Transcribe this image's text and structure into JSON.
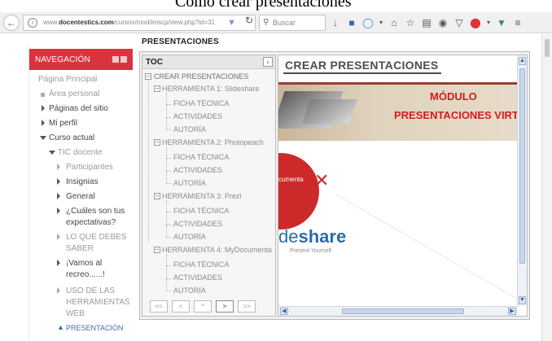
{
  "caption": "Cómo crear presentaciones",
  "browser": {
    "url_prefix": "www.",
    "url_domain": "docentestics.com",
    "url_path": "/cursos/mod/imscp/view.php?id=31",
    "search_placeholder": "Buscar",
    "icons": [
      "download-icon",
      "pocket-icon",
      "sync-icon",
      "home-icon",
      "bookmark-star-icon",
      "reader-icon",
      "chat-icon",
      "shield-icon",
      "adblock-icon",
      "vpn-icon",
      "menu-icon"
    ]
  },
  "nav": {
    "header": "NAVEGACIÓN",
    "items": {
      "home": "Página Principal",
      "personal": "Área personal",
      "site_pages": "Páginas del sitio",
      "profile": "Mi perfil",
      "current_course": "Curso actual",
      "tic": "TIC docente",
      "participants": "Participantes",
      "badges": "Insignias",
      "general": "General",
      "expect_1": "¿Cuáles son tus",
      "expect_2": "expectativas?",
      "know_1": "LO QUE DEBES",
      "know_2": "SABER",
      "recess_1": "¡Vamos al",
      "recess_2": "recreo......!",
      "tools_1": "USO DE LAS",
      "tools_2": "HERRAMIENTAS",
      "tools_3": "WEB",
      "presentation": "PRESENTACIÓN"
    }
  },
  "main": {
    "page_title": "PRESENTACIONES",
    "toc": {
      "title": "TOC",
      "root": "CREAR PRESENTACIONES",
      "tools": [
        {
          "label": "HERRAMIENTA 1: Slideshare",
          "children": [
            "FICHA TÉCNICA",
            "ACTIVIDADES",
            "AUTORÍA"
          ]
        },
        {
          "label": "HERRAMIENTA 2: Photopeach",
          "children": [
            "FICHA TÉCNICA",
            "ACTIVIDADES",
            "AUTORÍA"
          ]
        },
        {
          "label": "HERRAMIENTA 3: Prezi",
          "children": [
            "FICHA TÉCNICA",
            "ACTIVIDADES",
            "AUTORÍA"
          ]
        },
        {
          "label": "HERRAMIENTA 4: MyDocumenta",
          "children": [
            "FICHA TÉCNICA",
            "ACTIVIDADES",
            "AUTORÍA"
          ]
        }
      ],
      "pager": [
        "<<",
        "<",
        "^",
        ">",
        ">>"
      ]
    },
    "content": {
      "title": "CREAR PRESENTACIONES",
      "banner_line1": "MÓDULO",
      "banner_line2": "PRESENTACIONES VIRTU",
      "disc_text": "cumenta",
      "logo_part1": "de",
      "logo_part2": "share",
      "logo_sub": "Present Yourself"
    }
  },
  "colors": {
    "nav_header": "#d9343e",
    "banner_red": "#d6191f",
    "slideshare_blue": "#2c6ca8"
  }
}
